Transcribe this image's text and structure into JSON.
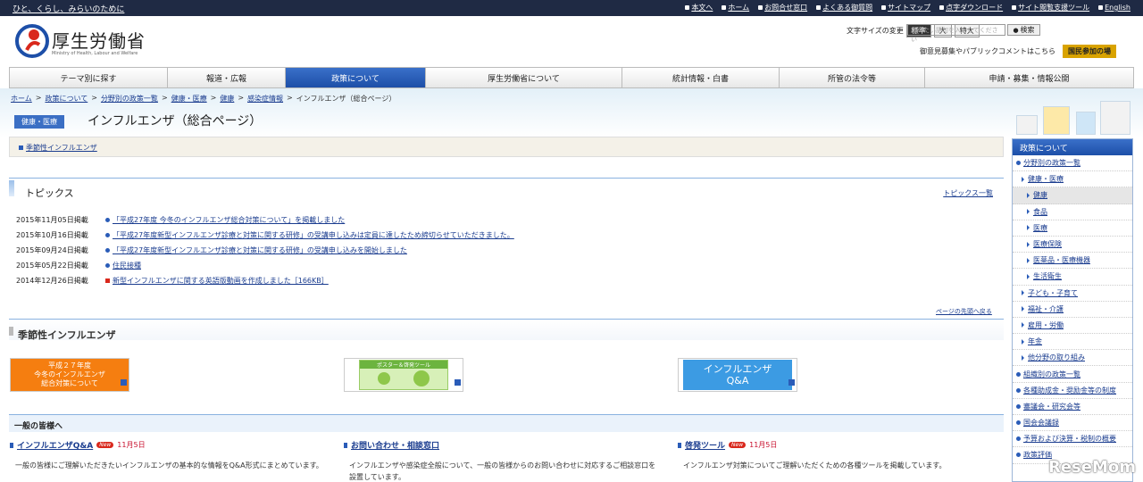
{
  "topbar": {
    "tagline": "ひと、くらし、みらいのために",
    "links": [
      "本文へ",
      "ホーム",
      "お問合せ窓口",
      "よくある御質問",
      "サイトマップ",
      "点字ダウンロード",
      "サイト閲覧支援ツール",
      "English"
    ]
  },
  "header": {
    "org_name": "厚生労働省",
    "org_name_en": "Ministry of Health, Labour and Welfare",
    "fontsize_label": "文字サイズの変更",
    "fontsize_options": [
      "標準",
      "大",
      "特大"
    ],
    "search_placeholder": "調べたい語句を入力してください",
    "search_button": "検索",
    "public_comment": "御意見募集やパブリックコメントはこちら",
    "join_button": "国民参加の場"
  },
  "gnav": {
    "items": [
      "テーマ別に探す",
      "報道・広報",
      "政策について",
      "厚生労働省について",
      "統計情報・白書",
      "所管の法令等",
      "申請・募集・情報公開"
    ],
    "active_index": 2
  },
  "breadcrumb": [
    "ホーム",
    "政策について",
    "分野別の政策一覧",
    "健康・医療",
    "健康",
    "感染症情報",
    "インフルエンザ（総合ページ）"
  ],
  "page": {
    "category": "健康・医療",
    "title": "インフルエンザ（総合ページ）",
    "anchor_link": "季節性インフルエンザ"
  },
  "topics": {
    "title": "トピックス",
    "more": "トピックス一覧",
    "items": [
      {
        "date": "2015年11月05日掲載",
        "text": "「平成27年度 今冬のインフルエンザ総合対策について」を掲載しました"
      },
      {
        "date": "2015年10月16日掲載",
        "text": "「平成27年度新型インフルエンザ診療と対策に関する研修」の受講申し込みは定員に達したため締切らせていただきました。"
      },
      {
        "date": "2015年09月24日掲載",
        "text": "「平成27年度新型インフルエンザ診療と対策に関する研修」の受講申し込みを開始しました"
      },
      {
        "date": "2015年05月22日掲載",
        "text": "住民接種"
      },
      {
        "date": "2014年12月26日掲載",
        "text": "新型インフルエンザに関する英語版動画を作成しました［166KB］"
      }
    ],
    "pagetop": "ページの先頭へ戻る"
  },
  "seasonal": {
    "title": "季節性インフルエンザ",
    "banner1": [
      "平成２７年度",
      "今冬のインフルエンザ",
      "総合対策について"
    ],
    "banner2_caption": "ポスター＆啓発ツール",
    "banner3": [
      "インフルエンザ",
      "Q&A"
    ]
  },
  "general": {
    "title": "一般の皆様へ",
    "cards": [
      {
        "title": "インフルエンザQ&A",
        "new": "New",
        "date": "11月5日",
        "desc": "一般の皆様にご理解いただきたいインフルエンザの基本的な情報をQ&A形式にまとめています。"
      },
      {
        "title": "お問い合わせ・相談窓口",
        "new": "",
        "date": "",
        "desc": "インフルエンザや感染症全般について、一般の皆様からのお問い合わせに対応するご相談窓口を設置しています。"
      },
      {
        "title": "啓発ツール",
        "new": "New",
        "date": "11月5日",
        "desc": "インフルエンザ対策についてご理解いただくための各種ツールを掲載しています。"
      }
    ]
  },
  "side": {
    "head": "政策について",
    "items": [
      {
        "label": "分野別の政策一覧",
        "level": 1
      },
      {
        "label": "健康・医療",
        "level": 2
      },
      {
        "label": "健康",
        "level": 3,
        "current": true
      },
      {
        "label": "食品",
        "level": 3
      },
      {
        "label": "医療",
        "level": 3
      },
      {
        "label": "医療保険",
        "level": 3
      },
      {
        "label": "医薬品・医療機器",
        "level": 3
      },
      {
        "label": "生活衛生",
        "level": 3
      },
      {
        "label": "子ども・子育て",
        "level": 2
      },
      {
        "label": "福祉・介護",
        "level": 2
      },
      {
        "label": "雇用・労働",
        "level": 2
      },
      {
        "label": "年金",
        "level": 2
      },
      {
        "label": "他分野の取り組み",
        "level": 2
      },
      {
        "label": "組織別の政策一覧",
        "level": 1
      },
      {
        "label": "各種助成金・奨励金等の制度",
        "level": 1
      },
      {
        "label": "審議会・研究会等",
        "level": 1
      },
      {
        "label": "国会会議録",
        "level": 1
      },
      {
        "label": "予算および決算・税制の概要",
        "level": 1
      },
      {
        "label": "政策評価",
        "level": 1
      }
    ]
  },
  "watermark": "ReseMom",
  "colors": {
    "nav_active": "#1d4fa8",
    "topbar": "#1f2a44",
    "banner_orange": "#f57e10",
    "banner_blue": "#3c9be3"
  }
}
